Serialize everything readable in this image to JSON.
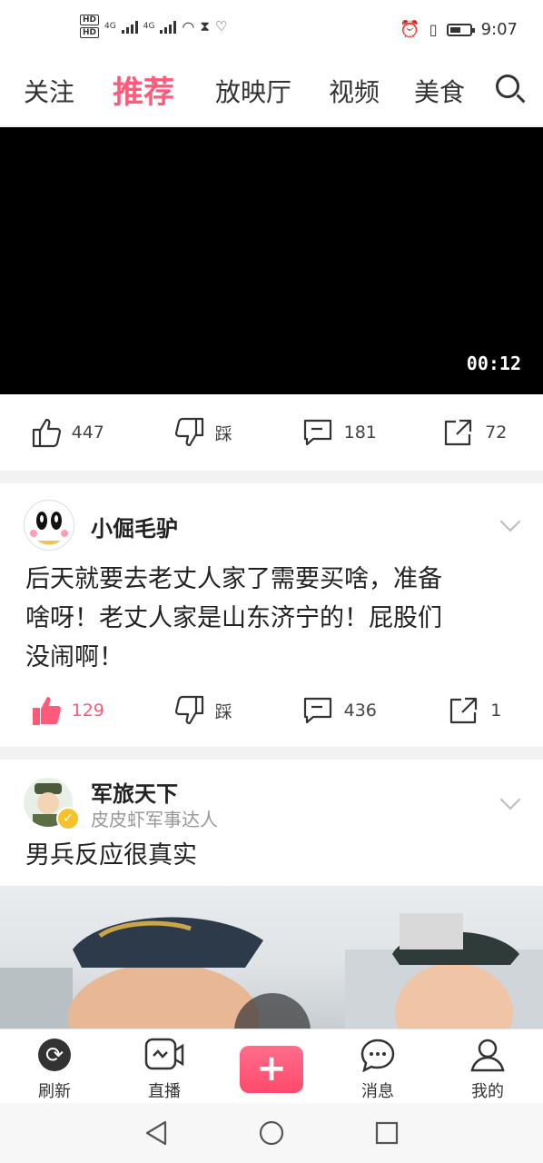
{
  "status_bar": {
    "time": "9:07",
    "network_left": [
      "4G",
      "4G"
    ],
    "hd_badges": [
      "HD",
      "HD"
    ]
  },
  "tabs": [
    {
      "label": "关注",
      "active": false
    },
    {
      "label": "推荐",
      "active": true
    },
    {
      "label": "放映厅",
      "active": false
    },
    {
      "label": "视频",
      "active": false
    },
    {
      "label": "美食",
      "active": false
    }
  ],
  "video": {
    "duration": "00:12"
  },
  "post1_actions": {
    "like": "447",
    "dislike": "踩",
    "comment": "181",
    "share": "72"
  },
  "post2": {
    "author": "小倔毛驴",
    "text_lines": [
      "后天就要去老丈人家了需要买啥，准备",
      "啥呀！老丈人家是山东济宁的！屁股们",
      "没闹啊！"
    ],
    "actions": {
      "like": "129",
      "dislike": "踩",
      "comment": "436",
      "share": "1"
    }
  },
  "post3": {
    "author": "军旅天下",
    "subtitle": "皮皮虾军事达人",
    "text": "男兵反应很真实"
  },
  "bottom_nav": {
    "refresh": "刷新",
    "live": "直播",
    "messages": "消息",
    "mine": "我的"
  },
  "colors": {
    "accent": "#ff5a7a",
    "video_bg": "#000000"
  }
}
